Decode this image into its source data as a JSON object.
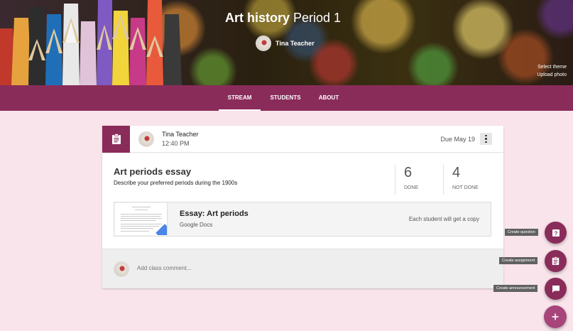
{
  "banner": {
    "title_bold": "Art history",
    "title_rest": " Period 1",
    "teacher_name": "Tina Teacher",
    "select_theme": "Select theme",
    "upload_photo": "Upload photo"
  },
  "tabs": [
    {
      "label": "STREAM",
      "active": true
    },
    {
      "label": "STUDENTS",
      "active": false
    },
    {
      "label": "ABOUT",
      "active": false
    }
  ],
  "post": {
    "author": "Tina Teacher",
    "time": "12:40 PM",
    "due": "Due May 19",
    "title": "Art periods essay",
    "description": "Describe your preferred periods during the 1900s",
    "done_count": "6",
    "done_label": "DONE",
    "not_done_count": "4",
    "not_done_label": "NOT DONE",
    "attachment": {
      "title": "Essay: Art periods",
      "source": "Google Docs",
      "note": "Each student will get a copy"
    },
    "comment_placeholder": "Add class comment..."
  },
  "actions": {
    "create_question": "Create question",
    "create_assignment": "Create assignment",
    "create_announcement": "Create announcement"
  },
  "colors": {
    "primary": "#8a2c5a",
    "background": "#f8e4ea"
  }
}
